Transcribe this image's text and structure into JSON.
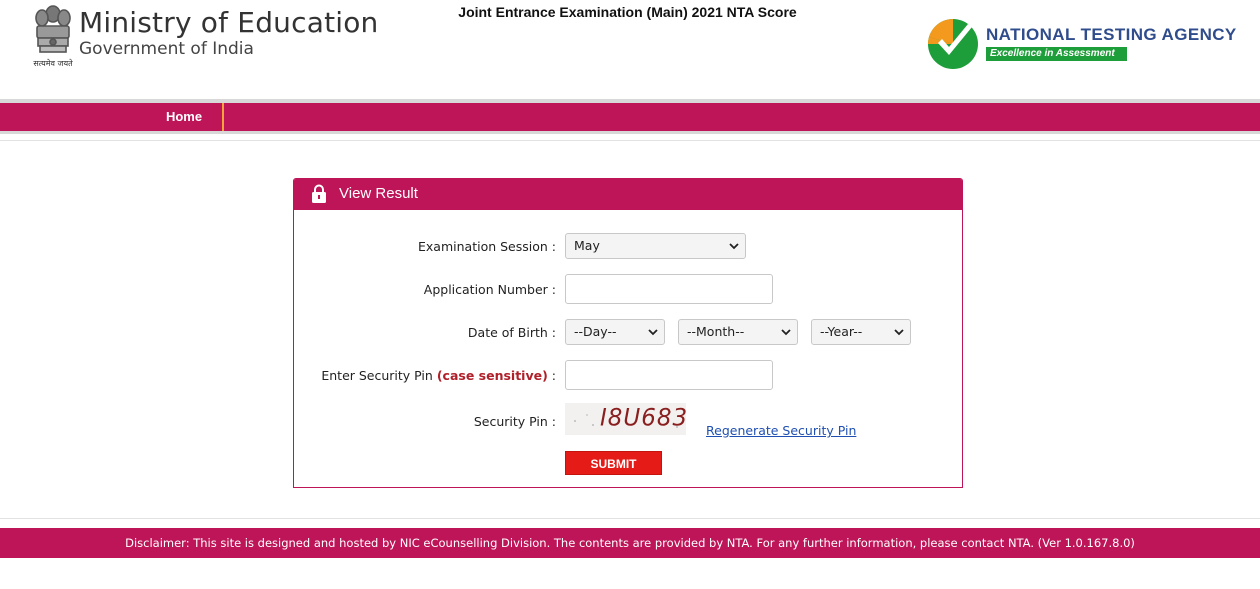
{
  "header": {
    "ministry_title": "Ministry of Education",
    "ministry_subtitle": "Government of India",
    "emblem_motto": "सत्यमेव जयते",
    "exam_title": "Joint Entrance Examination (Main) 2021 NTA Score",
    "nta_name": "NATIONAL TESTING AGENCY",
    "nta_tagline": "Excellence in Assessment"
  },
  "nav": {
    "home_label": "Home"
  },
  "panel": {
    "title": "View Result",
    "icon": "lock-icon",
    "fields": {
      "exam_session_label": "Examination Session :",
      "exam_session_value": "May",
      "application_number_label": "Application Number :",
      "application_number_value": "",
      "dob_label": "Date of Birth :",
      "dob_day": "--Day--",
      "dob_month": "--Month--",
      "dob_year": "--Year--",
      "security_pin_entry_label": "Enter Security Pin",
      "case_sensitive_note": "(case sensitive)",
      "security_pin_entry_colon": ":",
      "security_pin_entry_value": "",
      "security_pin_label": "Security Pin :",
      "captcha_text": "I8U683",
      "regenerate_link": "Regenerate Security Pin"
    },
    "submit_label": "SUBMIT"
  },
  "footer": {
    "disclaimer": "Disclaimer: This site is designed and hosted by NIC eCounselling Division. The contents are provided by NTA. For any further information, please contact NTA. (Ver 1.0.167.8.0)"
  },
  "colors": {
    "brand": "#be1458",
    "submit": "#e41b17",
    "nav_divider": "#f2a33a",
    "nta_blue": "#2f4c8c",
    "nta_green": "#1e9e3a",
    "link": "#1f4fb0",
    "case_note": "#b0202a"
  }
}
